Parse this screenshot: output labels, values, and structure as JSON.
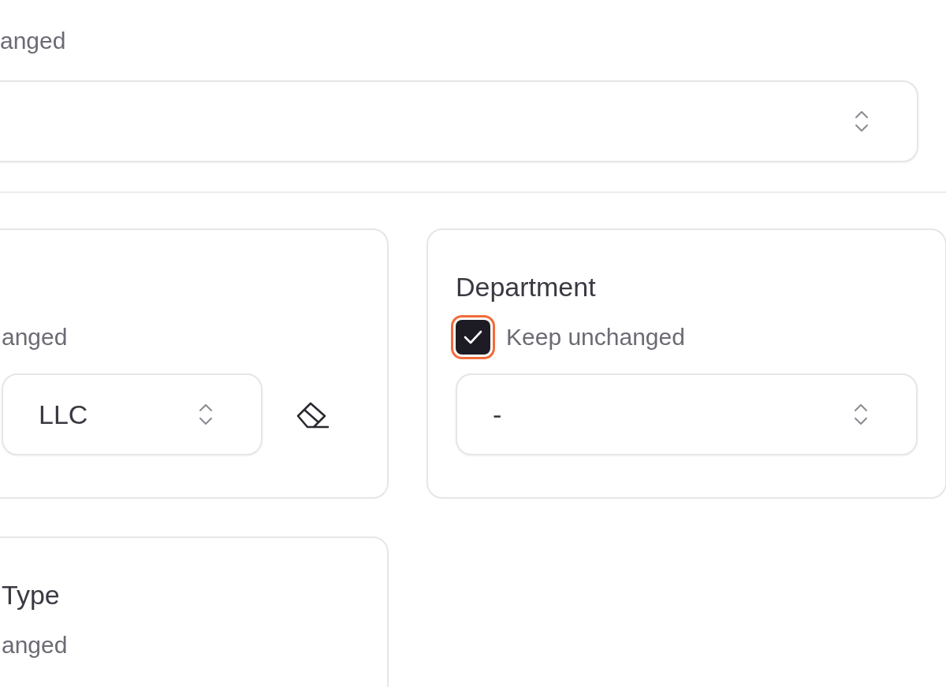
{
  "top": {
    "keep_label": "anged"
  },
  "cards": [
    {
      "keep_label": "anged",
      "select": {
        "value": "LLC"
      },
      "clear_button": true
    },
    {
      "title": "Department",
      "checkbox": {
        "checked": true,
        "focused": true
      },
      "keep_label": "Keep unchanged",
      "select": {
        "value": "-"
      },
      "clear_button": false
    },
    {
      "title": "Type",
      "keep_label": "anged"
    }
  ]
}
